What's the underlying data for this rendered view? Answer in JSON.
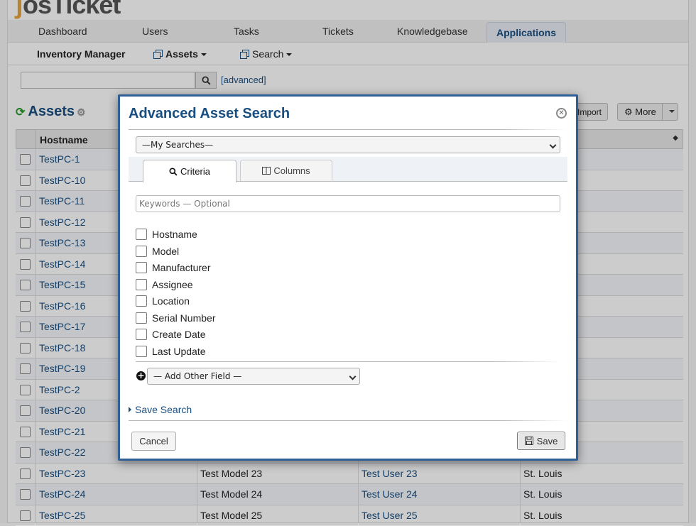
{
  "logo": {
    "mark": "ʃ",
    "text": "osTicket"
  },
  "nav": {
    "tabs": [
      {
        "label": "Dashboard"
      },
      {
        "label": "Users"
      },
      {
        "label": "Tasks"
      },
      {
        "label": "Tickets"
      },
      {
        "label": "Knowledgebase"
      },
      {
        "label": "Applications",
        "active": true
      }
    ]
  },
  "subnav": {
    "app": "Inventory Manager",
    "assets": "Assets",
    "search": "Search"
  },
  "search": {
    "value": "",
    "advanced": "[advanced]"
  },
  "assets": {
    "title": "Assets",
    "import_label": "Import",
    "more_label": "More"
  },
  "table": {
    "header_hostname": "Hostname",
    "rows": [
      {
        "host": "TestPC-1",
        "model": "",
        "user": "",
        "loc": ""
      },
      {
        "host": "TestPC-10",
        "model": "",
        "user": "",
        "loc": ""
      },
      {
        "host": "TestPC-11",
        "model": "",
        "user": "",
        "loc": ""
      },
      {
        "host": "TestPC-12",
        "model": "",
        "user": "",
        "loc": ""
      },
      {
        "host": "TestPC-13",
        "model": "",
        "user": "",
        "loc": ""
      },
      {
        "host": "TestPC-14",
        "model": "",
        "user": "",
        "loc": ""
      },
      {
        "host": "TestPC-15",
        "model": "",
        "user": "",
        "loc": ""
      },
      {
        "host": "TestPC-16",
        "model": "",
        "user": "",
        "loc": ""
      },
      {
        "host": "TestPC-17",
        "model": "",
        "user": "",
        "loc": ""
      },
      {
        "host": "TestPC-18",
        "model": "",
        "user": "",
        "loc": ""
      },
      {
        "host": "TestPC-19",
        "model": "",
        "user": "",
        "loc": ""
      },
      {
        "host": "TestPC-2",
        "model": "",
        "user": "",
        "loc": ""
      },
      {
        "host": "TestPC-20",
        "model": "",
        "user": "",
        "loc": ""
      },
      {
        "host": "TestPC-21",
        "model": "",
        "user": "",
        "loc": ""
      },
      {
        "host": "TestPC-22",
        "model": "",
        "user": "",
        "loc": ""
      },
      {
        "host": "TestPC-23",
        "model": "Test Model 23",
        "user": "Test User 23",
        "loc": "St. Louis"
      },
      {
        "host": "TestPC-24",
        "model": "Test Model 24",
        "user": "Test User 24",
        "loc": "St. Louis"
      },
      {
        "host": "TestPC-25",
        "model": "Test Model 25",
        "user": "Test User 25",
        "loc": "St. Louis"
      }
    ]
  },
  "dialog": {
    "title": "Advanced Asset Search",
    "my_searches": "—My Searches—",
    "tabs": {
      "criteria": "Criteria",
      "columns": "Columns"
    },
    "keywords_placeholder": "Keywords — Optional",
    "criteria": [
      {
        "label": "Hostname",
        "checked": false
      },
      {
        "label": "Model",
        "checked": false
      },
      {
        "label": "Manufacturer",
        "checked": false
      },
      {
        "label": "Assignee",
        "checked": false
      },
      {
        "label": "Location",
        "checked": false
      },
      {
        "label": "Serial Number",
        "checked": false
      },
      {
        "label": "Create Date",
        "checked": false
      },
      {
        "label": "Last Update",
        "checked": false
      }
    ],
    "add_field": "— Add Other Field —",
    "save_search": "Save Search",
    "cancel": "Cancel",
    "save": "Save"
  },
  "colors": {
    "link": "#184e81",
    "dialog_border": "#2f5f94",
    "refresh": "#2a9a2a"
  }
}
